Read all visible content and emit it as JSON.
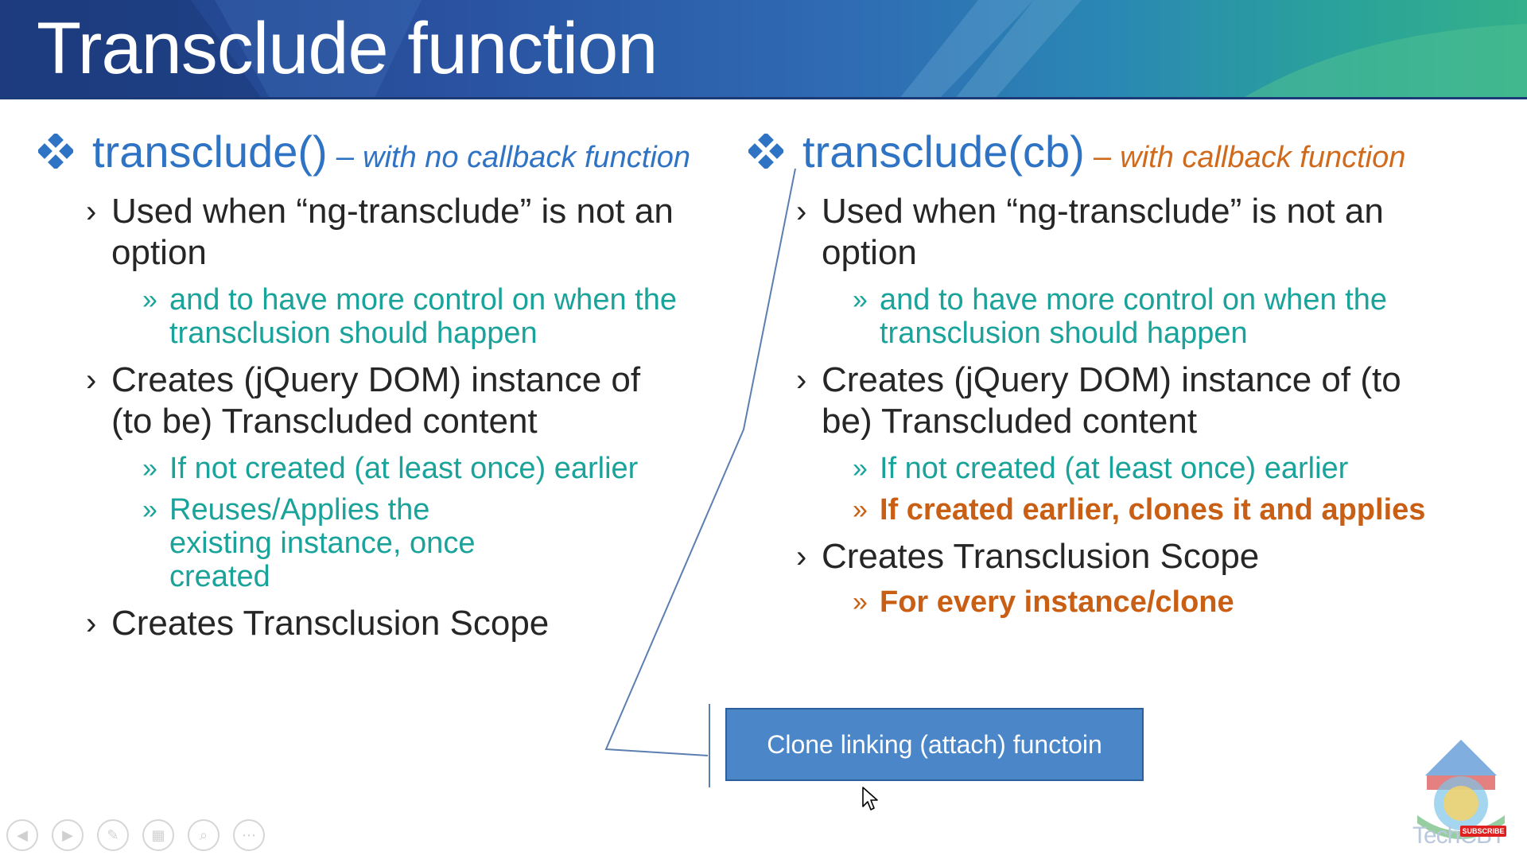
{
  "slide": {
    "title": "Transclude function"
  },
  "left": {
    "heading_main": "transclude()",
    "heading_sep": " – ",
    "heading_sub": "with no callback function",
    "bullet1": "Used when “ng-transclude” is not an option",
    "bullet1_sub1": "and to have more control on when the transclusion should happen",
    "bullet2": "Creates (jQuery DOM) instance of (to be) Transcluded content",
    "bullet2_sub1": "If not created (at least once) earlier",
    "bullet2_sub2": "Reuses/Applies the existing instance, once created",
    "bullet3": "Creates Transclusion Scope"
  },
  "right": {
    "heading_main": "transclude(cb)",
    "heading_sep": " – ",
    "heading_sub": "with callback function",
    "bullet1": "Used when “ng-transclude” is not an option",
    "bullet1_sub1": "and to have more control on when the transclusion should happen",
    "bullet2": "Creates (jQuery DOM) instance of (to be) Transcluded content",
    "bullet2_sub1": "If not created (at least once) earlier",
    "bullet2_sub2": "If created earlier, clones it and applies",
    "bullet3": "Creates Transclusion Scope",
    "bullet3_sub1": "For every instance/clone"
  },
  "callout": {
    "label": "Clone linking (attach)  functoin"
  },
  "logo": {
    "text": "TechCBT",
    "badge": "SUBSCRIBE"
  },
  "toolbar": {
    "buttons": [
      "previous-icon",
      "next-icon",
      "pen-icon",
      "slides-icon",
      "zoom-icon",
      "more-icon"
    ]
  },
  "colors": {
    "heading_blue": "#2f73c4",
    "teal": "#1aa39a",
    "orange": "#c85f14",
    "callout_fill": "#4a86c8"
  }
}
